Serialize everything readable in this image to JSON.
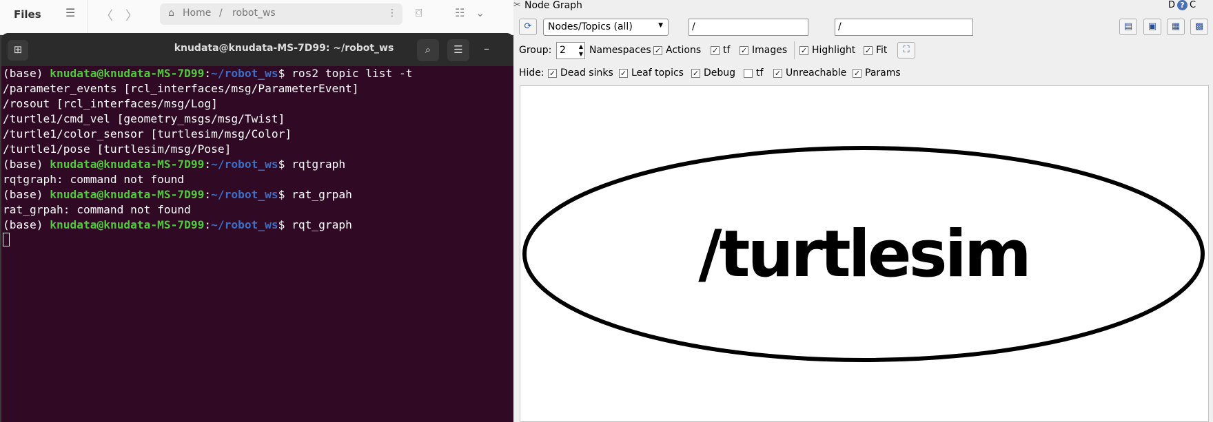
{
  "files_window": {
    "title": "Files",
    "path_home": "Home",
    "path_sep": "/",
    "path_folder": "robot_ws"
  },
  "terminal": {
    "title": "knudata@knudata-MS-7D99: ~/robot_ws",
    "prompt_env": "(base) ",
    "prompt_user": "knudata@knudata-MS-7D99",
    "prompt_colon": ":",
    "prompt_path": "~/robot_ws",
    "prompt_dollar": "$ ",
    "commands": [
      "ros2 topic list -t",
      "rqtgraph",
      "rat_grpah",
      "rqt_graph"
    ],
    "output": {
      "topics": [
        "/parameter_events [rcl_interfaces/msg/ParameterEvent]",
        "/rosout [rcl_interfaces/msg/Log]",
        "/turtle1/cmd_vel [geometry_msgs/msg/Twist]",
        "/turtle1/color_sensor [turtlesim/msg/Color]",
        "/turtle1/pose [turtlesim/msg/Pose]"
      ],
      "err1": "rqtgraph: command not found",
      "err2": "rat_grpah: command not found"
    }
  },
  "rqt": {
    "window_title": "Node Graph",
    "corner_d": "D",
    "corner_c": "C",
    "mode_select": "Nodes/Topics (all)",
    "filter1": "/",
    "filter2": "/",
    "group_label": "Group:",
    "group_value": "2",
    "options": {
      "namespaces": "Namespaces",
      "actions": "Actions",
      "tf": "tf",
      "images": "Images",
      "highlight": "Highlight",
      "fit": "Fit"
    },
    "hide_label": "Hide:",
    "hide": {
      "dead_sinks": "Dead sinks",
      "leaf_topics": "Leaf topics",
      "debug": "Debug",
      "tf": "tf",
      "unreachable": "Unreachable",
      "params": "Params"
    },
    "check_mark": "✓",
    "graph_node": "/turtlesim"
  }
}
